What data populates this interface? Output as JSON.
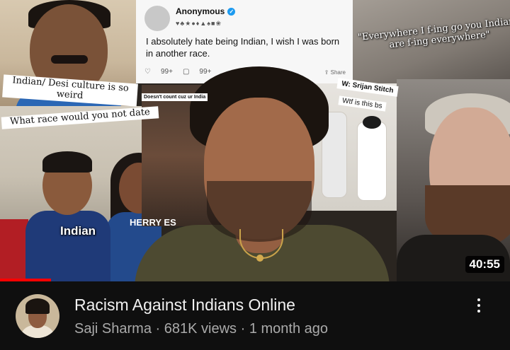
{
  "video": {
    "title": "Racism Against Indians Online",
    "channel": "Saji Sharma",
    "views": "681K views",
    "age": "1 month ago",
    "separator": "·",
    "duration": "40:55",
    "progress_fraction": 0.1,
    "progress_color": "#ff0000"
  },
  "thumbnail": {
    "tweet": {
      "author": "Anonymous",
      "emoji_row": "♥♣★●♦▲♠■❀",
      "text": "I absolutely hate being Indian, I wish I was born in another race.",
      "likes": "99+",
      "retweets": "99+",
      "share": "Share"
    },
    "captions": {
      "indian_desi": "Indian/ Desi culture is so weird",
      "race_date": "What race would you not date",
      "everywhere": "\"Everywhere I f-ing go you Indians are f-ing everywhere\"",
      "srijan": "W: Srijan Stitch",
      "wtf": "Wtf is this bs",
      "indian_tag": "Indian",
      "herry": "HERRY ES",
      "dont_count": "Doesn't count cuz ur India"
    }
  },
  "menu": {
    "icon": "more-vert-icon"
  }
}
